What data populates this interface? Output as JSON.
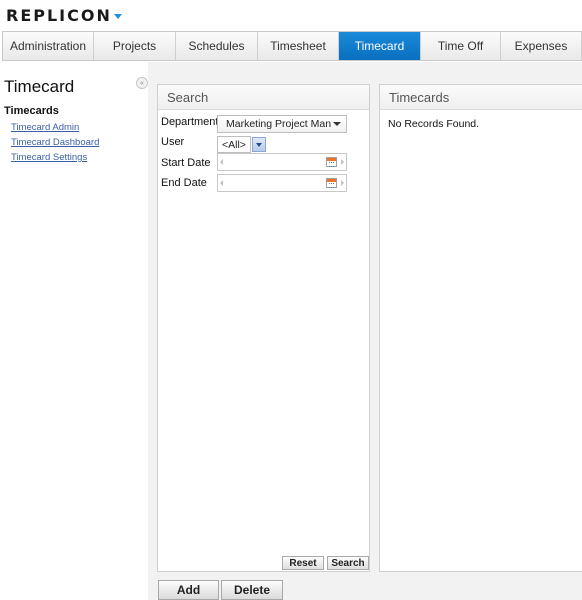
{
  "brand": {
    "logo_text": "REPLICON",
    "accent_color": "#1f8fe0"
  },
  "tabs": [
    {
      "label": "Administration",
      "active": false
    },
    {
      "label": "Projects",
      "active": false
    },
    {
      "label": "Schedules",
      "active": false
    },
    {
      "label": "Timesheet",
      "active": false
    },
    {
      "label": "Timecard",
      "active": true
    },
    {
      "label": "Time Off",
      "active": false
    },
    {
      "label": "Expenses",
      "active": false
    }
  ],
  "sidebar": {
    "title": "Timecard",
    "collapse_glyph": "«",
    "section": "Timecards",
    "links": [
      "Timecard Admin",
      "Timecard Dashboard",
      "Timecard Settings"
    ]
  },
  "search_panel": {
    "title": "Search",
    "fields": {
      "department_label": "Department",
      "department_value": "Marketing Project Man",
      "user_label": "User",
      "user_value": "<All>",
      "start_date_label": "Start Date",
      "start_date_value": "",
      "end_date_label": "End Date",
      "end_date_value": ""
    },
    "reset_label": "Reset",
    "search_label": "Search"
  },
  "timecards_panel": {
    "title": "Timecards",
    "empty_message": "No Records Found."
  },
  "actions": {
    "add_label": "Add",
    "delete_label": "Delete"
  },
  "colors": {
    "active_tab": "#0f7bcb",
    "link": "#3a5fa8",
    "calendar_icon": "#e8742e"
  }
}
